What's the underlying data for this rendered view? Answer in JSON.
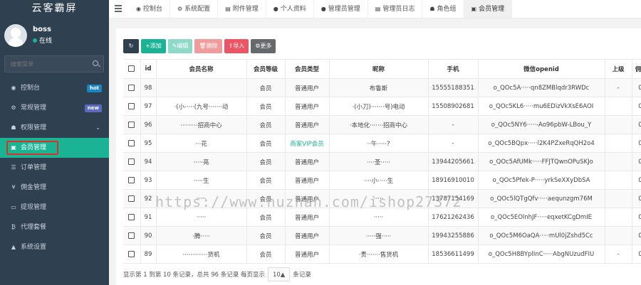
{
  "brand": "云客霸屏",
  "user": {
    "name": "boss",
    "status": "在线"
  },
  "search": {
    "placeholder": "搜索菜单"
  },
  "nav": [
    {
      "label": "控制台",
      "icon": "dashboard-icon",
      "badge": "hot"
    },
    {
      "label": "常规管理",
      "icon": "cogs-icon",
      "badge": "new"
    },
    {
      "label": "权限管理",
      "icon": "group-icon",
      "chevron": "⌄"
    },
    {
      "label": "会员管理",
      "icon": "id-card-icon",
      "active": true
    },
    {
      "label": "订单管理",
      "icon": "list-icon"
    },
    {
      "label": "佣金管理",
      "icon": "yen-icon"
    },
    {
      "label": "提现管理",
      "icon": "money-icon"
    },
    {
      "label": "代理套餐",
      "icon": "bitcoin-icon"
    },
    {
      "label": "系统设置",
      "icon": "warning-icon"
    }
  ],
  "tabs": [
    {
      "label": "控制台",
      "icon": "dashboard-icon"
    },
    {
      "label": "系统配置",
      "icon": "cog-icon"
    },
    {
      "label": "附件管理",
      "icon": "file-image-icon"
    },
    {
      "label": "个人资料",
      "icon": "user-icon"
    },
    {
      "label": "管理员管理",
      "icon": "user-icon"
    },
    {
      "label": "管理员日志",
      "icon": "list-alt-icon"
    },
    {
      "label": "角色组",
      "icon": "group-icon"
    },
    {
      "label": "会员管理",
      "icon": "id-card-icon",
      "active": true
    }
  ],
  "toolbar": {
    "add": "添加",
    "edit": "编辑",
    "delete": "删除",
    "import": "导入",
    "more": "更多"
  },
  "table": {
    "headers": [
      "id",
      "会员名称",
      "会员等级",
      "会员类型",
      "昵称",
      "手机",
      "微信openid",
      "上级",
      "佣金"
    ],
    "rows": [
      {
        "id": "98",
        "name": "",
        "level": "会员",
        "type": "普通用户",
        "nick": "布鲁斯",
        "phone": "15555188351",
        "openid": "o_QOc5A·····qn8ZMBlqdr3RWDc",
        "parent": "-",
        "comm": "0."
      },
      {
        "id": "97",
        "name": "·(小·····(九号·······动",
        "level": "会员",
        "type": "普通用户",
        "nick": "·(小刀)·······号)电动",
        "phone": "15508902681",
        "openid": "o_QOc5KL6·····mu6EDizVkXsE6AOI",
        "parent": "",
        "comm": "0."
      },
      {
        "id": "96",
        "name": "·········招商中心",
        "level": "会员",
        "type": "普通用户",
        "nick": "·本地化·······招商中心",
        "phone": "-",
        "openid": "o_QOc5NY6·····-Ao96pbW-LBou_Y",
        "parent": "",
        "comm": "0."
      },
      {
        "id": "95",
        "name": "···花",
        "level": "会员",
        "type": "商家VIP会员",
        "nick": "··午·····?",
        "phone": "-",
        "openid": "o_QOc5BQpx·····l2K4PZxeRqQH2o4",
        "parent": "",
        "comm": "0."
      },
      {
        "id": "94",
        "name": "·····亮",
        "level": "会员",
        "type": "普通用户",
        "nick": "····圣·····",
        "phone": "13944205661",
        "openid": "o_QOc5AfUMk·····FFJTQwnOPuSKJo",
        "parent": "",
        "comm": "0."
      },
      {
        "id": "93",
        "name": "·····生",
        "level": "会员",
        "type": "普通用户",
        "nick": "····小·····生",
        "phone": "18916910010",
        "openid": "o_QOc5Pfek-P·····yrkSeXXyDbSA",
        "parent": "",
        "comm": "0."
      },
      {
        "id": "92",
        "name": "·····",
        "level": "会员",
        "type": "普通用户",
        "nick": "·····",
        "phone": "13787154169",
        "openid": "o_QOc5lQTgQfv·····aequnzgm76M",
        "parent": "",
        "comm": "0."
      },
      {
        "id": "91",
        "name": "·····",
        "level": "会员",
        "type": "普通用户",
        "nick": "·····",
        "phone": "17621262436",
        "openid": "o_QOc5EOlnhJF·····eqxetKCgDmIE",
        "parent": "",
        "comm": "0."
      },
      {
        "id": "90",
        "name": "·腾·····",
        "level": "会员",
        "type": "普通用户",
        "nick": "·····强·····",
        "phone": "19943255886",
        "openid": "o_QOc5M6OaQA·····mUl0jZshd5Cc",
        "parent": "",
        "comm": "0."
      },
      {
        "id": "89",
        "name": "·············货机",
        "level": "会员",
        "type": "普通用户",
        "nick": "·贵·······售货机",
        "phone": "18536611499",
        "openid": "o_QOc5H8BYplInC·····AbgNUzudFIU",
        "parent": "-",
        "comm": "0."
      }
    ]
  },
  "footer": {
    "prefix": "显示第 1 到第 10 条记录，总共 96 条记录 每页显示",
    "page_size": "10▲",
    "suffix": "条记录"
  },
  "watermark": "https://www.huzhan.com/ishop27372",
  "colors": {
    "sidebar": "#2f4050",
    "accent": "#1ab394",
    "danger": "#ed5565"
  }
}
